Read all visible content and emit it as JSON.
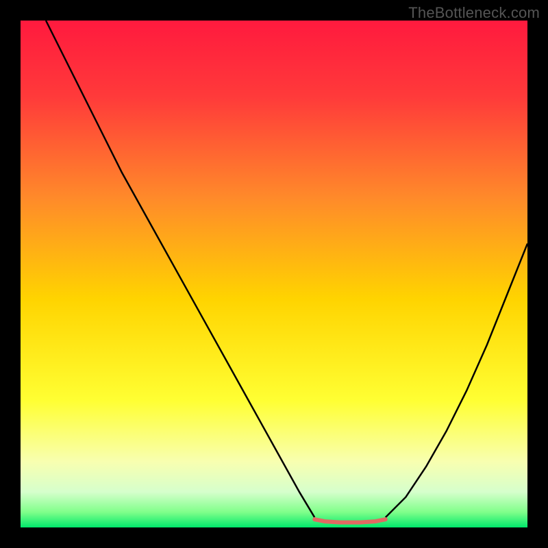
{
  "watermark": "TheBottleneck.com",
  "chart_data": {
    "type": "line",
    "title": "",
    "xlabel": "",
    "ylabel": "",
    "xlim": [
      0,
      100
    ],
    "ylim": [
      0,
      100
    ],
    "gradient_stops": [
      {
        "offset": 0.0,
        "color": "#ff1a3e"
      },
      {
        "offset": 0.15,
        "color": "#ff3a3a"
      },
      {
        "offset": 0.35,
        "color": "#ff8a2a"
      },
      {
        "offset": 0.55,
        "color": "#ffd400"
      },
      {
        "offset": 0.75,
        "color": "#ffff33"
      },
      {
        "offset": 0.87,
        "color": "#f8ffb0"
      },
      {
        "offset": 0.93,
        "color": "#d6ffcc"
      },
      {
        "offset": 0.97,
        "color": "#7fff8a"
      },
      {
        "offset": 1.0,
        "color": "#00e86b"
      }
    ],
    "series": [
      {
        "name": "bottleneck-curve-left",
        "color": "#000000",
        "width": 2.5,
        "x": [
          5,
          10,
          15,
          20,
          25,
          30,
          35,
          40,
          45,
          50,
          55,
          58
        ],
        "y": [
          100,
          90,
          80,
          70,
          61,
          52,
          43,
          34,
          25,
          16,
          7,
          2
        ]
      },
      {
        "name": "bottleneck-curve-right",
        "color": "#000000",
        "width": 2.5,
        "x": [
          72,
          76,
          80,
          84,
          88,
          92,
          96,
          100
        ],
        "y": [
          2,
          6,
          12,
          19,
          27,
          36,
          46,
          56
        ]
      },
      {
        "name": "optimal-flat",
        "color": "#e16a62",
        "width": 6,
        "linecap": "round",
        "x": [
          58,
          60,
          63,
          67,
          70,
          72
        ],
        "y": [
          1.6,
          1.2,
          1.0,
          1.0,
          1.2,
          1.6
        ]
      }
    ]
  }
}
